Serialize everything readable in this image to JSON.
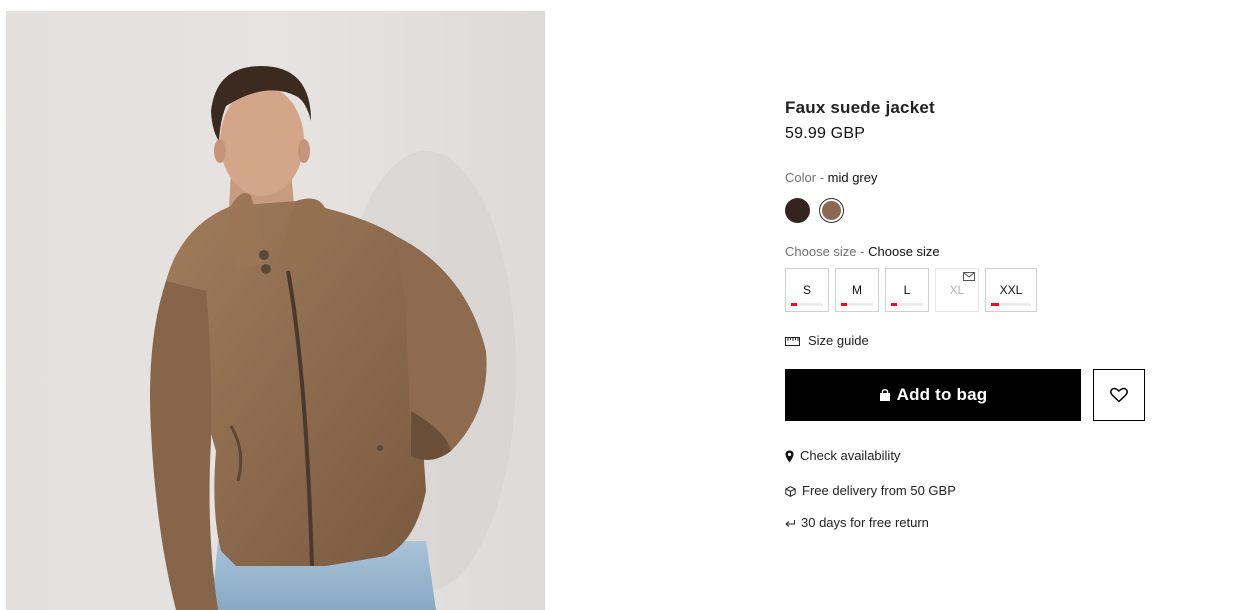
{
  "product": {
    "title": "Faux suede jacket",
    "price": "59.99 GBP",
    "image_alt": "Model wearing faux suede jacket"
  },
  "color": {
    "label": "Color",
    "separator": " - ",
    "selected": "mid grey",
    "swatches": [
      {
        "name": "dark brown",
        "hex": "#34231e"
      },
      {
        "name": "mid grey",
        "hex": "#8c6850",
        "selected": true
      }
    ]
  },
  "size": {
    "label": "Choose size",
    "separator": " - ",
    "selected": "Choose size",
    "options": [
      {
        "label": "S",
        "available": true,
        "stock_indicator": 0.2
      },
      {
        "label": "M",
        "available": true,
        "stock_indicator": 0.2
      },
      {
        "label": "L",
        "available": true,
        "stock_indicator": 0.2
      },
      {
        "label": "XL",
        "available": false,
        "notify_icon": "envelope-icon"
      },
      {
        "label": "XXL",
        "available": true,
        "stock_indicator": 0.2
      }
    ],
    "guide_label": "Size guide"
  },
  "actions": {
    "add_to_bag": "Add to bag",
    "add_icon": "shopping-bag-icon",
    "wishlist_icon": "heart-icon"
  },
  "info": {
    "check_availability": "Check availability",
    "delivery": "Free delivery from 50 GBP",
    "returns": "30 days for free return"
  },
  "colors": {
    "primary_button": "#000000",
    "low_stock": "#e3131b"
  }
}
